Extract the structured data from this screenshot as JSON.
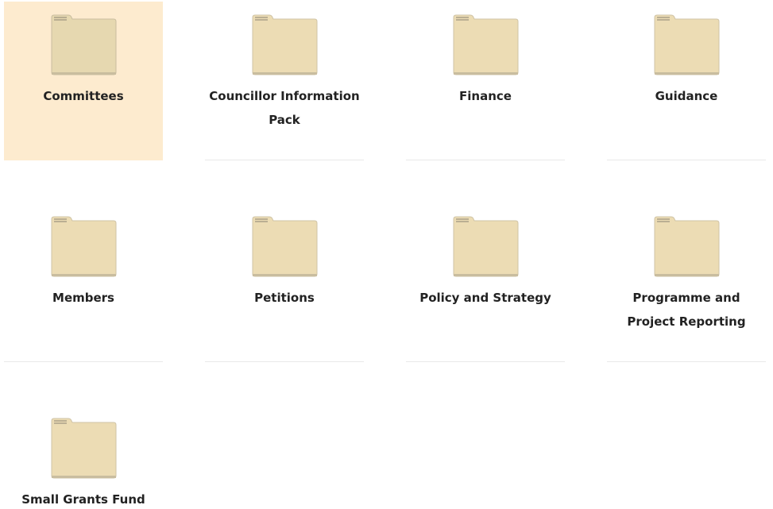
{
  "folders": [
    {
      "label": "Committees",
      "selected": true,
      "icon": "folder-icon"
    },
    {
      "label": "Councillor Information Pack",
      "selected": false,
      "icon": "folder-icon"
    },
    {
      "label": "Finance",
      "selected": false,
      "icon": "folder-icon"
    },
    {
      "label": "Guidance",
      "selected": false,
      "icon": "folder-icon"
    },
    {
      "label": "Members",
      "selected": false,
      "icon": "folder-icon"
    },
    {
      "label": "Petitions",
      "selected": false,
      "icon": "folder-icon"
    },
    {
      "label": "Policy and Strategy",
      "selected": false,
      "icon": "folder-icon"
    },
    {
      "label": "Programme and Project Reporting",
      "selected": false,
      "icon": "folder-icon"
    },
    {
      "label": "Small Grants Fund",
      "selected": false,
      "icon": "folder-icon"
    }
  ],
  "colors": {
    "selected_background": "#fdebcf",
    "folder_fill": "#ecdcb4",
    "folder_edge": "#bfb49a",
    "folder_tab_line": "#8a8272"
  }
}
